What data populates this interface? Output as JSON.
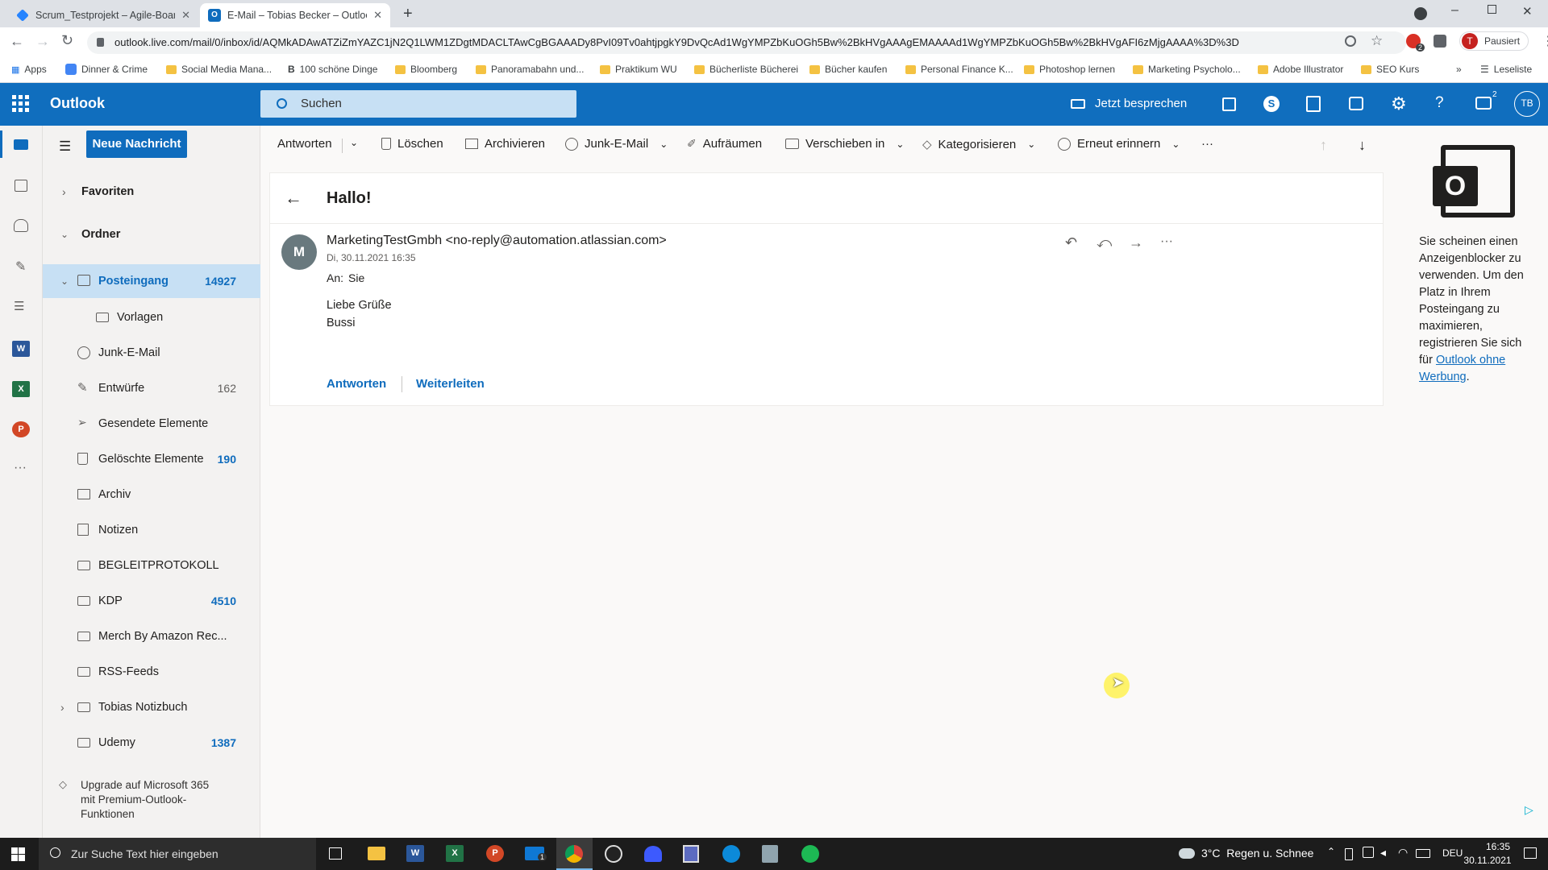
{
  "browser": {
    "tabs": [
      {
        "title": "Scrum_Testprojekt – Agile-Board",
        "active": false
      },
      {
        "title": "E-Mail – Tobias Becker – Outlook",
        "active": true
      }
    ],
    "url": "outlook.live.com/mail/0/inbox/id/AQMkADAwATZiZmYAZC1jN2Q1LWM1ZDgtMDACLTAwCgBGAAADy8PvI09Tv0ahtjpgkY9DvQcAd1WgYMPZbKuOGh5Bw%2BkHVgAAAgEMAAAAd1WgYMPZbKuOGh5Bw%2BkHVgAFI6zMjgAAAA%3D%3D",
    "profile_initial": "T",
    "profile_status": "Pausiert",
    "bookmarks": [
      "Apps",
      "Dinner & Crime",
      "Social Media Mana...",
      "100 schöne Dinge",
      "Bloomberg",
      "Panoramabahn und...",
      "Praktikum WU",
      "Bücherliste Bücherei",
      "Bücher kaufen",
      "Personal Finance K...",
      "Photoshop lernen",
      "Marketing Psycholo...",
      "Adobe Illustrator",
      "SEO Kurs"
    ],
    "reading_list": "Leseliste",
    "ext_badge": "2"
  },
  "header": {
    "app_name": "Outlook",
    "search_placeholder": "Suchen",
    "meet_now": "Jetzt besprechen",
    "notification_count": "2",
    "avatar": "TB"
  },
  "folder_pane": {
    "new_message": "Neue Nachricht",
    "favorites": "Favoriten",
    "folders_header": "Ordner",
    "folders": [
      {
        "name": "Posteingang",
        "count": "14927",
        "icon": "inbox-icon"
      },
      {
        "name": "Vorlagen",
        "count": "",
        "icon": "folder-icon"
      },
      {
        "name": "Junk-E-Mail",
        "count": "",
        "icon": "block-icon"
      },
      {
        "name": "Entwürfe",
        "count": "162",
        "icon": "pencil-icon"
      },
      {
        "name": "Gesendete Elemente",
        "count": "",
        "icon": "send-icon"
      },
      {
        "name": "Gelöschte Elemente",
        "count": "190",
        "icon": "trash-icon"
      },
      {
        "name": "Archiv",
        "count": "",
        "icon": "archive-icon"
      },
      {
        "name": "Notizen",
        "count": "",
        "icon": "note-icon"
      },
      {
        "name": "BEGLEITPROTOKOLL",
        "count": "",
        "icon": "folder-icon"
      },
      {
        "name": "KDP",
        "count": "4510",
        "icon": "folder-icon"
      },
      {
        "name": "Merch By Amazon Rec...",
        "count": "",
        "icon": "folder-icon"
      },
      {
        "name": "RSS-Feeds",
        "count": "",
        "icon": "folder-icon"
      },
      {
        "name": "Tobias Notizbuch",
        "count": "",
        "icon": "folder-icon"
      },
      {
        "name": "Udemy",
        "count": "1387",
        "icon": "folder-icon"
      }
    ],
    "upgrade_text": "Upgrade auf Microsoft 365 mit Premium-Outlook-Funktionen"
  },
  "toolbar": {
    "reply": "Antworten",
    "delete": "Löschen",
    "archive": "Archivieren",
    "junk": "Junk-E-Mail",
    "sweep": "Aufräumen",
    "move": "Verschieben in",
    "categorize": "Kategorisieren",
    "snooze": "Erneut erinnern",
    "more": "···"
  },
  "message": {
    "subject": "Hallo!",
    "sender_initial": "M",
    "sender": "MarketingTestGmbh <no-reply@automation.atlassian.com>",
    "date": "Di, 30.11.2021 16:35",
    "to_label": "An:",
    "to_value": "Sie",
    "body_line1": "Liebe Grüße",
    "body_line2": "Bussi",
    "reply_link": "Antworten",
    "forward_link": "Weiterleiten"
  },
  "ad_pane": {
    "text": "Sie scheinen einen Anzeigenblocker zu verwenden. Um den Platz in Ihrem Posteingang zu maximieren, registrieren Sie sich für",
    "link": "Outlook ohne Werbung",
    "suffix": "."
  },
  "taskbar": {
    "search_placeholder": "Zur Suche Text hier eingeben",
    "weather": "3°C  Regen u. Schnee",
    "lang": "DEU",
    "time": "16:35",
    "date": "30.11.2021",
    "mail_badge": "1"
  },
  "colors": {
    "brand": "#106ebe",
    "accent": "#0f6cbd",
    "selected": "#c7e0f4"
  }
}
